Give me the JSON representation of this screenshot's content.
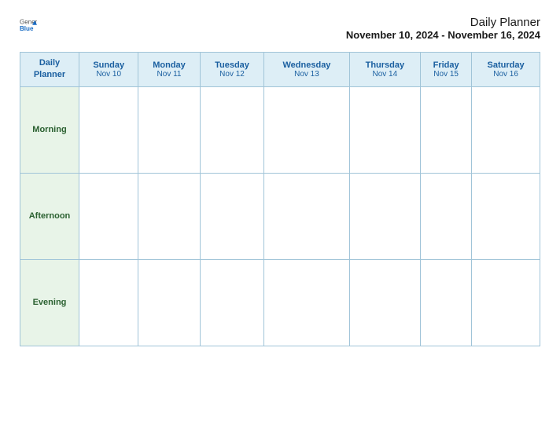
{
  "logo": {
    "text_general": "General",
    "text_blue": "Blue"
  },
  "title": {
    "main": "Daily Planner",
    "date_range": "November 10, 2024 - November 16, 2024"
  },
  "header_label": {
    "line1": "Daily",
    "line2": "Planner"
  },
  "days": [
    {
      "name": "Sunday",
      "date": "Nov 10"
    },
    {
      "name": "Monday",
      "date": "Nov 11"
    },
    {
      "name": "Tuesday",
      "date": "Nov 12"
    },
    {
      "name": "Wednesday",
      "date": "Nov 13"
    },
    {
      "name": "Thursday",
      "date": "Nov 14"
    },
    {
      "name": "Friday",
      "date": "Nov 15"
    },
    {
      "name": "Saturday",
      "date": "Nov 16"
    }
  ],
  "rows": [
    {
      "label": "Morning"
    },
    {
      "label": "Afternoon"
    },
    {
      "label": "Evening"
    }
  ]
}
